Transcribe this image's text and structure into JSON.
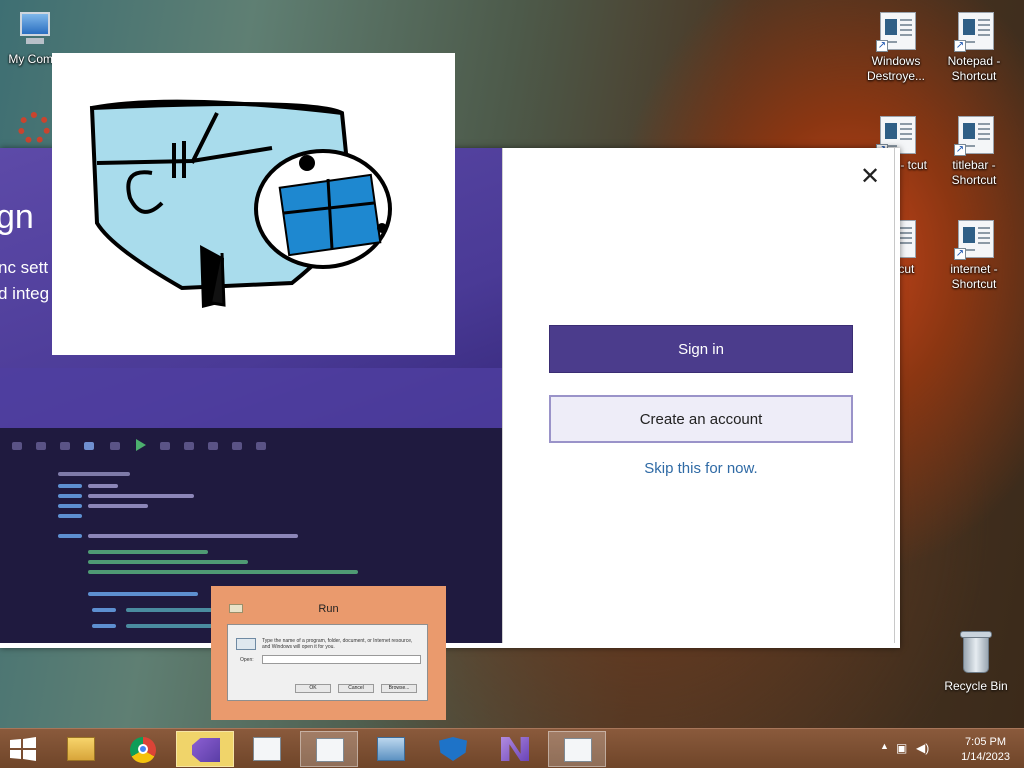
{
  "desktop": {
    "icons_left": [
      {
        "label": "My Comp"
      }
    ],
    "icons_right": [
      {
        "label": "Windows Destroye..."
      },
      {
        "label": "Notepad - Shortcut"
      },
      {
        "label": "STER - tcut"
      },
      {
        "label": "titlebar - Shortcut"
      },
      {
        "label": "n - tcut"
      },
      {
        "label": "internet - Shortcut"
      }
    ],
    "recycle_bin": "Recycle Bin"
  },
  "vs_window": {
    "heading_partial": "gn",
    "line1_partial": "nc sett",
    "line2_partial": "d integ",
    "sign_in_label": "Sign in",
    "create_account_label": "Create an account",
    "skip_label": "Skip this for now.",
    "close_symbol": "✕",
    "accent": "#4b3c8c"
  },
  "run_dialog": {
    "title": "Run",
    "description": "Type the name of a program, folder, document, or Internet resource, and Windows will open it for you.",
    "open_label": "Open:",
    "open_value": "",
    "ok": "OK",
    "cancel": "Cancel",
    "browse": "Browse..."
  },
  "taskbar": {
    "items": [
      {
        "name": "file-explorer-icon"
      },
      {
        "name": "chrome-icon"
      },
      {
        "name": "vs-installer-icon"
      },
      {
        "name": "window-app-icon"
      },
      {
        "name": "window-app-icon"
      },
      {
        "name": "remote-desktop-icon"
      },
      {
        "name": "defender-icon"
      },
      {
        "name": "visual-studio-icon"
      },
      {
        "name": "window-app-icon"
      }
    ],
    "time": "7:05 PM",
    "date": "1/14/2023"
  }
}
